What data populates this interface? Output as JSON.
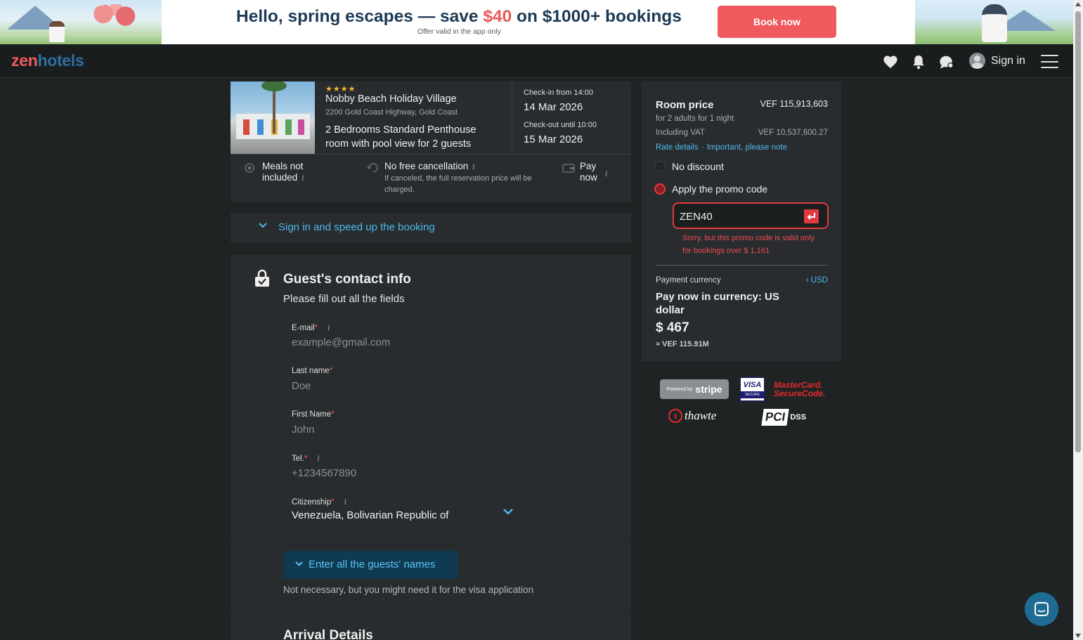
{
  "banner": {
    "headline_part1": "Hello, spring escapes — save ",
    "headline_accent": "$40",
    "headline_part2": " on $1000+ bookings",
    "subtext": "Offer valid in the app only",
    "cta_label": "Book now"
  },
  "nav": {
    "logo_zen": "zen",
    "logo_hotels": "hotels",
    "signin_label": "Sign in",
    "icons": [
      "heart-icon",
      "bell-icon",
      "chat-icon",
      "avatar",
      "menu-icon"
    ]
  },
  "hotel": {
    "stars": "★★★★",
    "name": "Nobby Beach Holiday Village",
    "address": "2200 Gold Coast Highway, Gold Coast",
    "room": "2 Bedrooms Standard Penthouse room with pool view for 2 guests",
    "checkin_label": "Check-in from 14:00",
    "checkin_date": "14 Mar 2026",
    "checkout_label": "Check-out until 10:00",
    "checkout_date": "15 Mar 2026",
    "features": {
      "meals": "Meals not included",
      "cancellation": "No free cancellation",
      "cancellation_note": "If canceled, the full reservation price will be charged.",
      "pay": "Pay now"
    },
    "info_glyph": "i"
  },
  "speedup": {
    "label": "Sign in and speed up the booking"
  },
  "contact": {
    "title": "Guest's contact info",
    "subtitle": "Please fill out all the fields",
    "required_mark": "*",
    "fields": {
      "email": {
        "label": "E-mail",
        "placeholder": "example@gmail.com",
        "value": ""
      },
      "last_name": {
        "label": "Last name",
        "placeholder": "Doe",
        "value": ""
      },
      "first_name": {
        "label": "First Name",
        "placeholder": "John",
        "value": ""
      },
      "tel": {
        "label": "Tel.",
        "placeholder": "+1234567890",
        "value": ""
      },
      "citizenship": {
        "label": "Citizenship",
        "value": "Venezuela, Bolivarian Republic of"
      }
    },
    "guests_button": "Enter all the guests' names",
    "guests_note": "Not necessary, but you might need it for the visa application",
    "arrival_title": "Arrival Details"
  },
  "price": {
    "title": "Room price",
    "total": "VEF 115,913,603",
    "subtitle": "for 2 adults  for 1 night",
    "vat_label": "Including VAT",
    "vat_value": "VEF 10,537,600.27",
    "rate_details": "Rate details",
    "dot": "·",
    "important": "Important, please note",
    "no_discount": "No discount",
    "apply_promo": "Apply the promo code",
    "selected_option": "apply_promo",
    "promo_value": "ZEN40",
    "promo_error": "Sorry, but this promo code is valid only for bookings over $ 1,161",
    "payment_currency_label": "Payment currency",
    "currency_link": "› USD",
    "pay_now_text": "Pay now in currency: US dollar",
    "amount": "$ 467",
    "approx": "≈ VEF 115.91M"
  },
  "security": {
    "stripe_powered": "Powered by",
    "stripe": "stripe",
    "visa": "VISA",
    "visa_secure": "SECURE",
    "mastercard_line1": "MasterCard.",
    "mastercard_line2": "SecureCode.",
    "thawte": "thawte",
    "pci": "PCI",
    "dss": "DSS"
  },
  "colors": {
    "accent": "#ef5b5e",
    "link": "#4fb8ee",
    "error": "#e1393d",
    "background": "#1f2324",
    "panel": "#282c2e"
  }
}
